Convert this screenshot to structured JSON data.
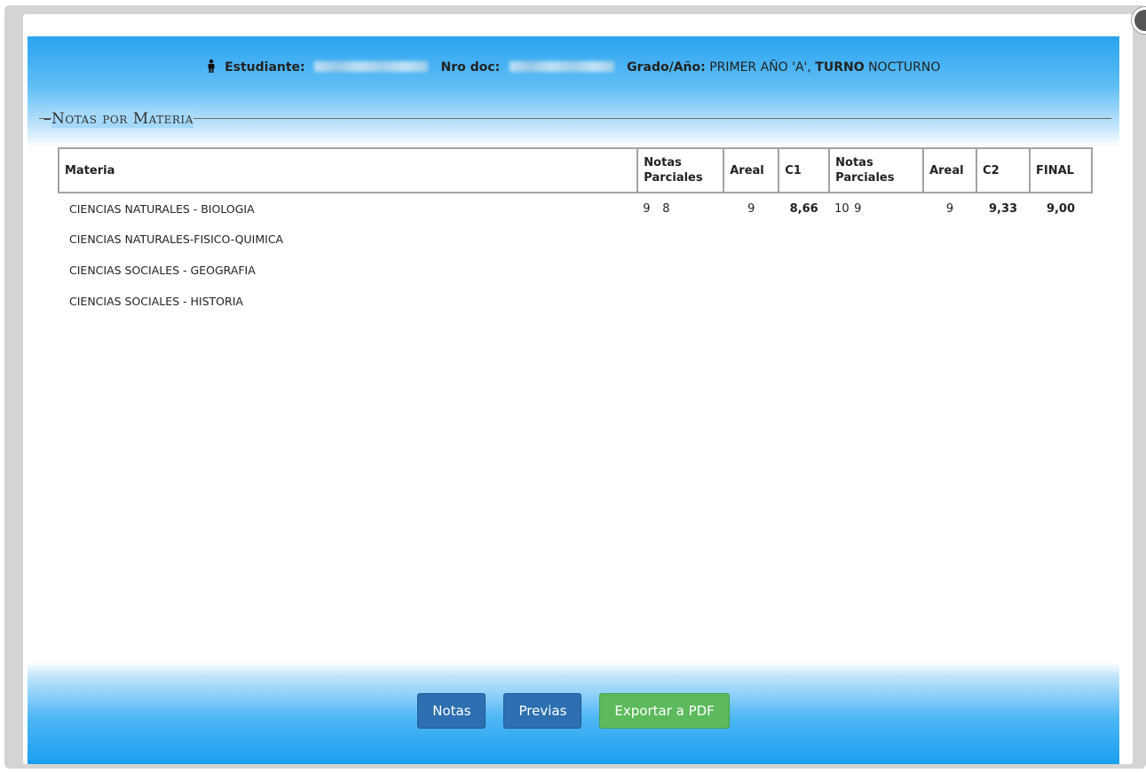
{
  "student": {
    "estudiante_label": "Estudiante:",
    "doc_label": "Nro doc:",
    "grado_label": "Grado/Año:",
    "grado_value": "PRIMER AÑO 'A',",
    "turno_label": "TURNO",
    "turno_value": "NOCTURNO"
  },
  "section_title": "Notas por Materia",
  "table": {
    "headers": {
      "materia": "Materia",
      "parciales1": "Notas Parciales",
      "areal1": "Areal",
      "c1": "C1",
      "parciales2": "Notas Parciales",
      "areal2": "Areal",
      "c2": "C2",
      "final": "FINAL"
    },
    "rows": [
      {
        "materia": "CIENCIAS NATURALES - BIOLOGIA",
        "p1a": "9",
        "p1b": "8",
        "areal1": "9",
        "c1": "8,66",
        "p2a": "10",
        "p2b": "9",
        "areal2": "9",
        "c2": "9,33",
        "final": "9,00"
      },
      {
        "materia": "CIENCIAS NATURALES-FISICO-QUIMICA",
        "p1a": "",
        "p1b": "",
        "areal1": "",
        "c1": "",
        "p2a": "",
        "p2b": "",
        "areal2": "",
        "c2": "",
        "final": ""
      },
      {
        "materia": "CIENCIAS SOCIALES - GEOGRAFIA",
        "p1a": "",
        "p1b": "",
        "areal1": "",
        "c1": "",
        "p2a": "",
        "p2b": "",
        "areal2": "",
        "c2": "",
        "final": ""
      },
      {
        "materia": "CIENCIAS SOCIALES - HISTORIA",
        "p1a": "",
        "p1b": "",
        "areal1": "",
        "c1": "",
        "p2a": "",
        "p2b": "",
        "areal2": "",
        "c2": "",
        "final": ""
      }
    ]
  },
  "buttons": {
    "notas": "Notas",
    "previas": "Previas",
    "exportar": "Exportar a PDF"
  },
  "colors": {
    "header_blue": "#29a3f0",
    "button_blue": "#2d6fb0",
    "button_green": "#5cba5c"
  }
}
